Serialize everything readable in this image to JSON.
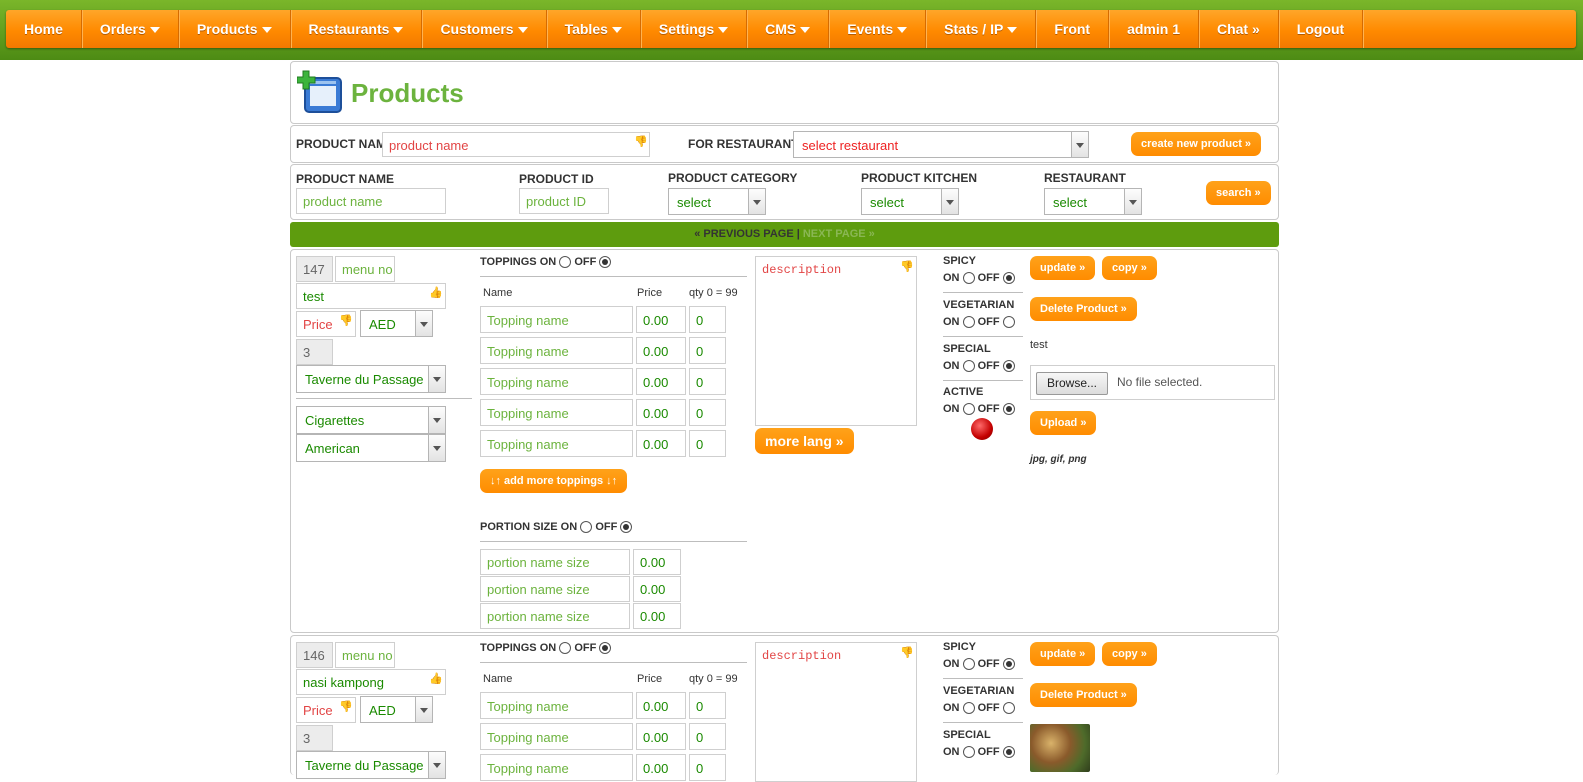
{
  "nav": [
    {
      "label": "Home",
      "caret": false
    },
    {
      "label": "Orders",
      "caret": true
    },
    {
      "label": "Products",
      "caret": true
    },
    {
      "label": "Restaurants",
      "caret": true
    },
    {
      "label": "Customers",
      "caret": true
    },
    {
      "label": "Tables",
      "caret": true
    },
    {
      "label": "Settings",
      "caret": true
    },
    {
      "label": "CMS",
      "caret": true
    },
    {
      "label": "Events",
      "caret": true
    },
    {
      "label": "Stats / IP",
      "caret": true
    },
    {
      "label": "Front",
      "caret": false
    },
    {
      "label": "admin 1",
      "caret": false
    },
    {
      "label": "Chat »",
      "caret": false
    },
    {
      "label": "Logout",
      "caret": false
    }
  ],
  "page_title": "Products",
  "create_bar": {
    "product_name_label": "PRODUCT NAME",
    "product_name_placeholder": "product name",
    "for_restaurant_label": "FOR RESTAURANT »",
    "restaurant_select": "select restaurant",
    "create_button": "create new product »"
  },
  "filter": {
    "name_label": "PRODUCT NAME",
    "name_placeholder": "product name",
    "id_label": "PRODUCT ID",
    "id_placeholder": "product ID",
    "category_label": "PRODUCT CATEGORY",
    "category_value": "select",
    "kitchen_label": "PRODUCT KITCHEN",
    "kitchen_value": "select",
    "restaurant_label": "RESTAURANT",
    "restaurant_value": "select",
    "search_button": "search »"
  },
  "pager": {
    "prev": "« PREVIOUS PAGE |",
    "next": " NEXT PAGE »"
  },
  "labels": {
    "toppings": "TOPPINGS ON",
    "off": "OFF",
    "on": "ON",
    "col_name": "Name",
    "col_price": "Price",
    "col_qty": "qty 0 = 99",
    "topping_placeholder": "Topping name",
    "add_toppings": "↓↑ add more toppings ↓↑",
    "portion": "PORTION SIZE ON",
    "portion_placeholder": "portion name size",
    "description_placeholder": "description",
    "more_lang": "more lang »",
    "spicy": "SPICY",
    "vegetarian": "VEGETARIAN",
    "special": "SPECIAL",
    "active": "ACTIVE",
    "update": "update »",
    "copy": "copy »",
    "delete": "Delete Product »",
    "browse": "Browse...",
    "no_file": "No file selected.",
    "upload": "Upload »",
    "file_types": "jpg, gif, png",
    "menu_no": "menu no",
    "price_placeholder": "Price"
  },
  "products": [
    {
      "id": "147",
      "name": "test",
      "currency": "AED",
      "sort": "3",
      "restaurant": "Taverne du Passage",
      "category": "Cigarettes",
      "kitchen": "American",
      "toppings": [
        {
          "price": "0.00",
          "qty": "0"
        },
        {
          "price": "0.00",
          "qty": "0"
        },
        {
          "price": "0.00",
          "qty": "0"
        },
        {
          "price": "0.00",
          "qty": "0"
        },
        {
          "price": "0.00",
          "qty": "0"
        }
      ],
      "portions": [
        {
          "price": "0.00"
        },
        {
          "price": "0.00"
        },
        {
          "price": "0.00"
        }
      ],
      "image_caption": "test"
    },
    {
      "id": "146",
      "name": "nasi kampong",
      "currency": "AED",
      "sort": "3",
      "restaurant": "Taverne du Passage",
      "toppings": [
        {
          "price": "0.00",
          "qty": "0"
        },
        {
          "price": "0.00",
          "qty": "0"
        },
        {
          "price": "0.00",
          "qty": "0"
        }
      ]
    }
  ],
  "colors": {
    "accent": "#ff8c00",
    "brand_green": "#6cb33e",
    "nav_bg": "#5e9c0e"
  }
}
